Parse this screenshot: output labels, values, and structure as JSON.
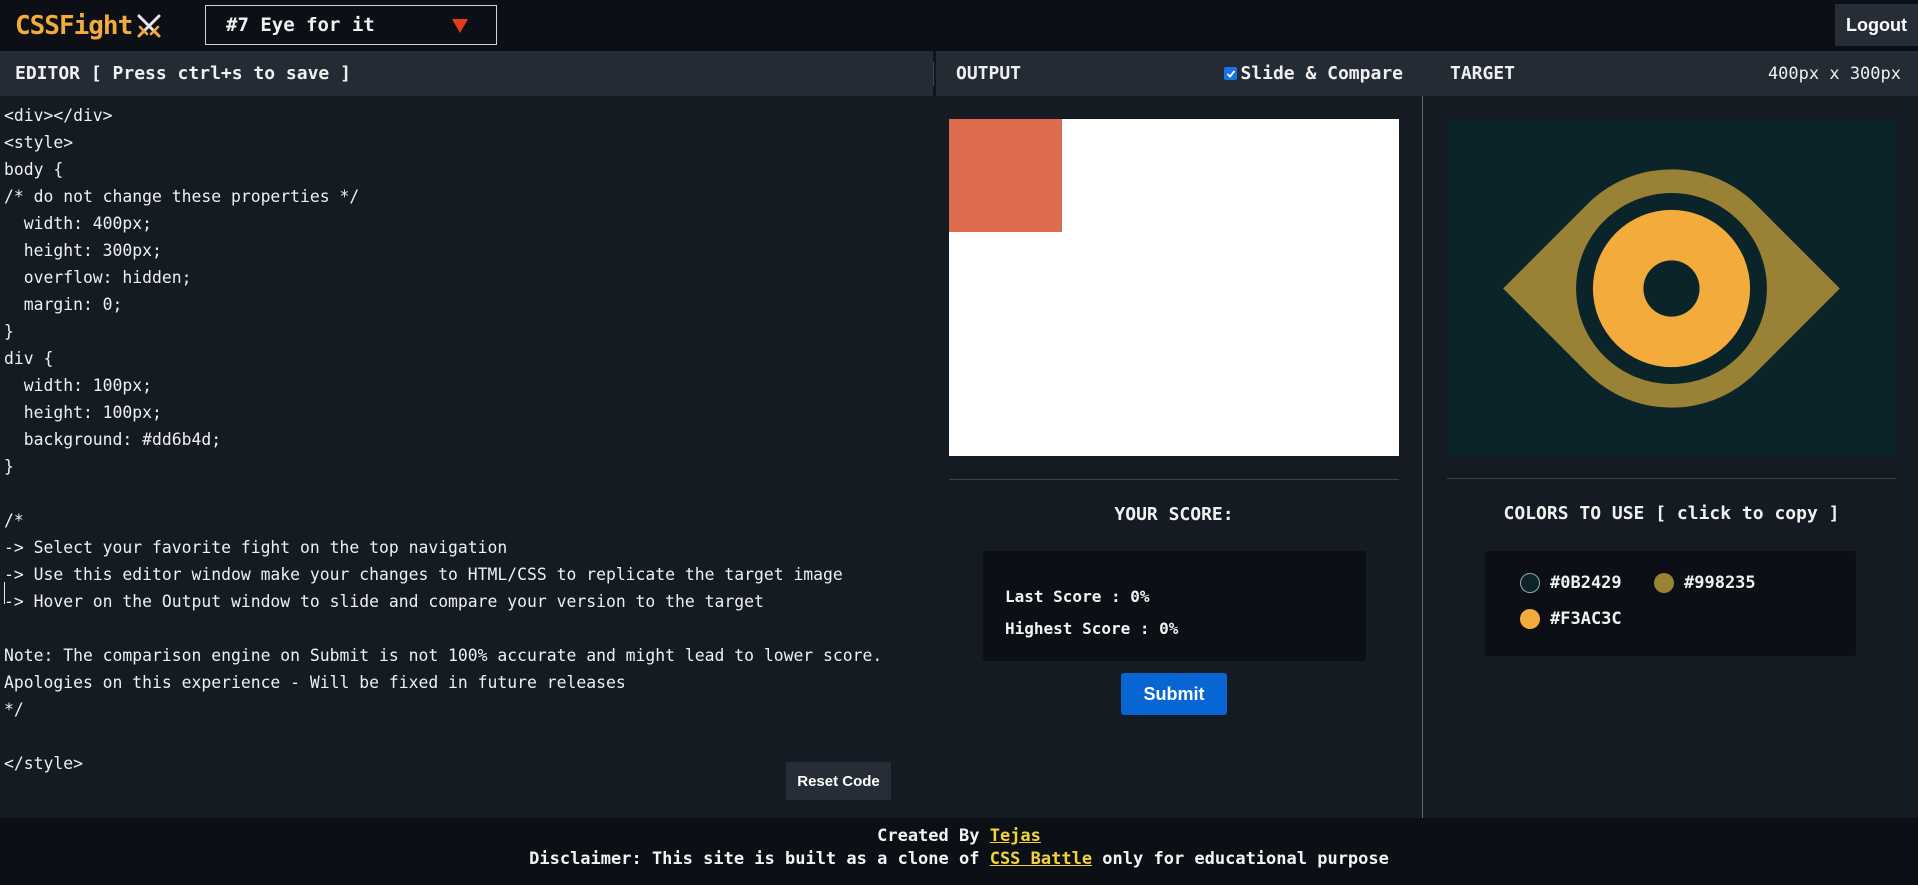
{
  "nav": {
    "logo_text": "CSSFight",
    "fight_select_label": "#7 Eye for it",
    "logout_label": "Logout"
  },
  "editor": {
    "header_label": "EDITOR [ Press ctrl+s to save ]",
    "code": "<div></div>\n<style>\nbody {\n/* do not change these properties */\n  width: 400px;\n  height: 300px;\n  overflow: hidden;\n  margin: 0;\n}\ndiv {\n  width: 100px;\n  height: 100px;\n  background: #dd6b4d;\n}\n\n/*\n-> Select your favorite fight on the top navigation\n-> Use this editor window make your changes to HTML/CSS to replicate the target image\n-> Hover on the Output window to slide and compare your version to the target\n\nNote: The comparison engine on Submit is not 100% accurate and might lead to lower score.\nApologies on this experience - Will be fixed in future releases\n*/\n\n</style>",
    "reset_label": "Reset Code"
  },
  "output": {
    "header_label": "OUTPUT",
    "slide_compare_label": "Slide & Compare",
    "slide_compare_checked": true,
    "render_box_color": "#dd6b4d",
    "score_title": "YOUR SCORE:",
    "last_score_label": "Last Score : 0%",
    "highest_score_label": "Highest Score : 0%",
    "submit_label": "Submit"
  },
  "target": {
    "header_label": "TARGET",
    "dimensions_label": "400px x 300px",
    "colors_title": "COLORS TO USE [ click to copy ]",
    "colors": [
      {
        "hex": "#0B2429"
      },
      {
        "hex": "#998235"
      },
      {
        "hex": "#F3AC3C"
      }
    ]
  },
  "footer": {
    "created_by_prefix": "Created By ",
    "author_link": "Tejas",
    "disclaimer_prefix": "Disclaimer: This site is built as a clone of ",
    "battle_link": "CSS Battle",
    "disclaimer_suffix": " only for educational purpose"
  }
}
